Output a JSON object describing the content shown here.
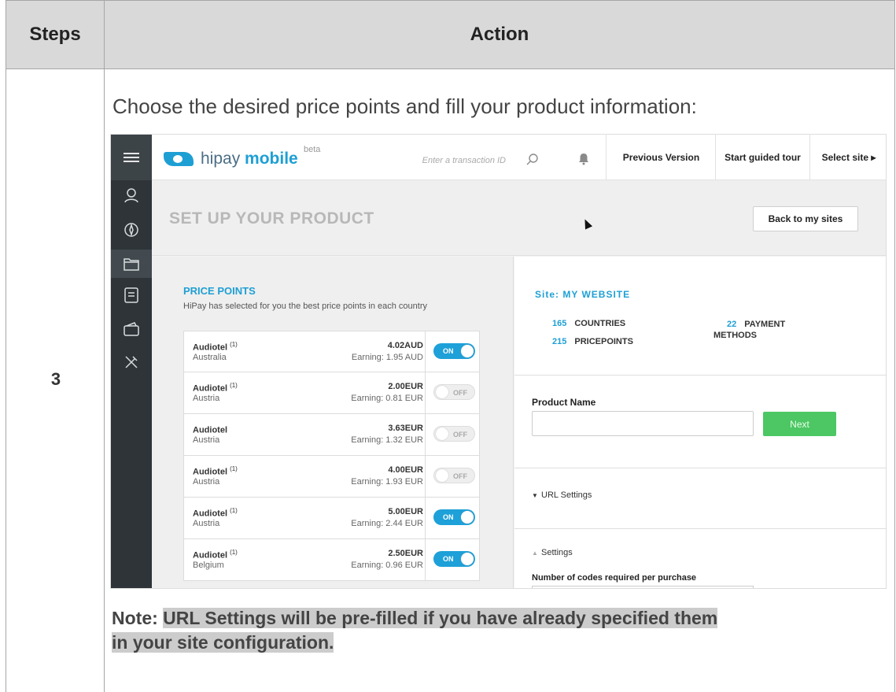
{
  "table": {
    "headers": {
      "steps": "Steps",
      "action": "Action"
    },
    "step_number": "3",
    "intro": "Choose the desired price points and fill your product information:",
    "note_label": "Note:",
    "note_text_1": "URL Settings will be pre-filled if you have already specified them",
    "note_text_2": "in your site configuration."
  },
  "app": {
    "logo_hipay": "hipay ",
    "logo_mobile": "mobile",
    "beta": "beta",
    "search_placeholder": "Enter a transaction ID",
    "topnav": {
      "previous_version": "Previous Version",
      "guided_tour": "Start guided tour",
      "select_site": "Select site ▸"
    },
    "sidebar_icons": [
      "menu-icon",
      "user-icon",
      "compass-icon",
      "folder-icon",
      "document-icon",
      "wallet-icon",
      "tools-icon"
    ],
    "page_title": "SET UP YOUR PRODUCT",
    "back_button": "Back to my sites",
    "price_points": {
      "title": "PRICE POINTS",
      "subtitle": "HiPay has selected for you the best price points in each country",
      "rows": [
        {
          "name": "Audiotel",
          "sup": "(1)",
          "country": "Australia",
          "price": "4.02AUD",
          "earning": "Earning: 1.95 AUD",
          "toggle": "ON"
        },
        {
          "name": "Audiotel",
          "sup": "(1)",
          "country": "Austria",
          "price": "2.00EUR",
          "earning": "Earning: 0.81 EUR",
          "toggle": "OFF"
        },
        {
          "name": "Audiotel",
          "sup": "",
          "country": "Austria",
          "price": "3.63EUR",
          "earning": "Earning: 1.32 EUR",
          "toggle": "OFF"
        },
        {
          "name": "Audiotel",
          "sup": "(1)",
          "country": "Austria",
          "price": "4.00EUR",
          "earning": "Earning: 1.93 EUR",
          "toggle": "OFF"
        },
        {
          "name": "Audiotel",
          "sup": "(1)",
          "country": "Austria",
          "price": "5.00EUR",
          "earning": "Earning: 2.44 EUR",
          "toggle": "ON"
        },
        {
          "name": "Audiotel",
          "sup": "(1)",
          "country": "Belgium",
          "price": "2.50EUR",
          "earning": "Earning: 0.96 EUR",
          "toggle": "ON"
        }
      ]
    },
    "site": {
      "title": "Site: MY WEBSITE",
      "countries_n": "165",
      "countries_label": "COUNTRIES",
      "pricepoints_n": "215",
      "pricepoints_label": "PRICEPOINTS",
      "payment_n": "22",
      "payment_label_1": "PAYMENT",
      "payment_label_2": "METHODS"
    },
    "product_name_label": "Product Name",
    "product_name_value": "",
    "next_button": "Next",
    "url_settings": "URL Settings",
    "settings": "Settings",
    "codes_label": "Number of codes required per purchase"
  }
}
